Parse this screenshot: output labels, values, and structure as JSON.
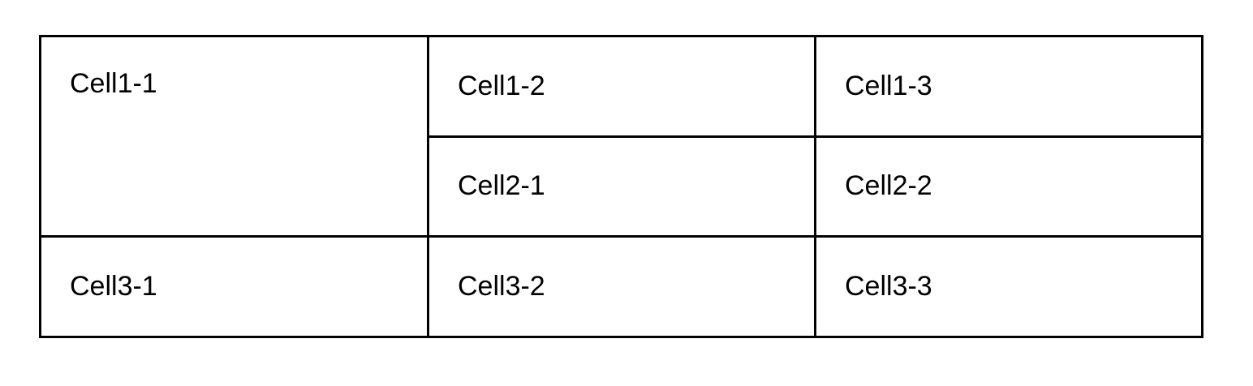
{
  "table": {
    "rows": [
      [
        "Cell1-1",
        "Cell1-2",
        "Cell1-3"
      ],
      [
        "Cell2-1",
        "Cell2-2"
      ],
      [
        "Cell3-1",
        "Cell3-2",
        "Cell3-3"
      ]
    ]
  },
  "colors": {
    "border": "#000000",
    "text": "#000000",
    "background": "#ffffff"
  }
}
